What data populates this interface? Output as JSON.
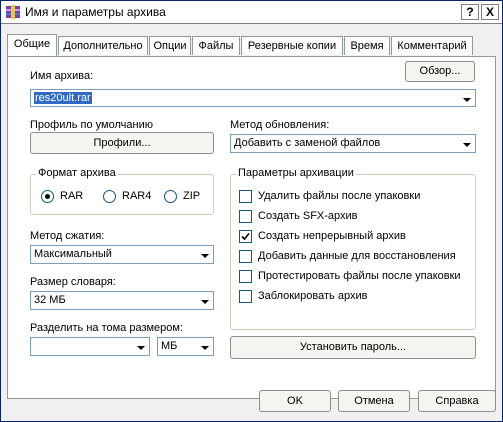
{
  "window": {
    "title": "Имя и параметры архива",
    "help_label": "?",
    "close_label": "X"
  },
  "tabs": [
    {
      "label": "Общие",
      "active": true
    },
    {
      "label": "Дополнительно",
      "active": false
    },
    {
      "label": "Опции",
      "active": false
    },
    {
      "label": "Файлы",
      "active": false
    },
    {
      "label": "Резервные копии",
      "active": false
    },
    {
      "label": "Время",
      "active": false
    },
    {
      "label": "Комментарий",
      "active": false
    }
  ],
  "archive_name": {
    "label": "Имя архива:",
    "value": "res20ult.rar",
    "browse_label": "Обзор..."
  },
  "profile": {
    "label": "Профиль по умолчанию",
    "button_label": "Профили..."
  },
  "update_method": {
    "label": "Метод обновления:",
    "value": "Добавить с заменой файлов"
  },
  "archive_format": {
    "label": "Формат архива",
    "options": [
      {
        "label": "RAR",
        "selected": true
      },
      {
        "label": "RAR4",
        "selected": false
      },
      {
        "label": "ZIP",
        "selected": false
      }
    ]
  },
  "compression": {
    "label": "Метод сжатия:",
    "value": "Максимальный"
  },
  "dictionary": {
    "label": "Размер словаря:",
    "value": "32 МБ"
  },
  "split": {
    "label": "Разделить на тома размером:",
    "value": "",
    "unit": "МБ"
  },
  "archive_params": {
    "label": "Параметры архивации",
    "options": [
      {
        "label": "Удалить файлы после упаковки",
        "checked": false
      },
      {
        "label": "Создать SFX-архив",
        "checked": false
      },
      {
        "label": "Создать непрерывный архив",
        "checked": true
      },
      {
        "label": "Добавить данные для восстановления",
        "checked": false
      },
      {
        "label": "Протестировать файлы после упаковки",
        "checked": false
      },
      {
        "label": "Заблокировать архив",
        "checked": false
      }
    ]
  },
  "password_button_label": "Установить пароль...",
  "footer": {
    "ok_label": "OK",
    "cancel_label": "Отмена",
    "help_label": "Справка"
  },
  "icons": {
    "app": "winrar-icon",
    "check": "checkmark-icon"
  }
}
